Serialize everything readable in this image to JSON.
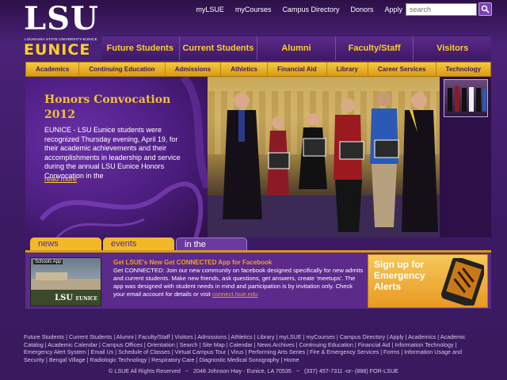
{
  "logo": {
    "main": "LSU",
    "tagline": "LOUISIANA STATE UNIVERSITY-EUNICE",
    "secondary": "EUNICE"
  },
  "utility_links": [
    "myLSUE",
    "myCourses",
    "Campus Directory",
    "Donors",
    "Apply"
  ],
  "search": {
    "placeholder": "search"
  },
  "main_nav": [
    "Future Students",
    "Current Students",
    "Alumni",
    "Faculty/Staff",
    "Visitors"
  ],
  "sub_nav": [
    "Academics",
    "Continuing Education",
    "Admissions",
    "Athletics",
    "Financial Aid",
    "Library",
    "Career Services",
    "Technology"
  ],
  "hero": {
    "title": "Honors Convocation 2012",
    "body": "EUNICE - LSU Eunice students were recognized Thursday evening, April 19, for their academic achievements and their accomplishments in leadership and service during the annual LSU Eunice Honors Convocation in the",
    "read_more": "read more"
  },
  "tabs": [
    "news",
    "events",
    "in the spotlight"
  ],
  "feature": {
    "image_label": "Schools App",
    "image_logo": "LSU",
    "image_logo_sub": "EUNICE",
    "title": "Get LSUE's New Get CONNECTED App for Facebook",
    "body": "Get CONNECTED: Join our new community on facebook designed specifically for new admits and current students. Make new friends, ask questions, get answers, create 'meetups'. The app was designed with student needs in mind and participation is by invitation only. Check your email account for details or visit ",
    "link": "connect.lsue.edu",
    "alerts_text": "Sign up for Emergency Alerts"
  },
  "footer": {
    "links": "Future Students | Current Students | Alumni | Faculty/Staff | Visitors | Admissions | Athletics | Library | myLSUE | myCourses | Campus Directory | Apply | Academics | Academic Catalog | Academic Calendar | Campus Offices | Orientation | Search | Site Map | Calendar | News Archives | Continuing Education | Financial Aid | Information Technology | Emergency Alert System | Email Us | Schedule of Classes | Virtual Campus Tour | Virus | Performing Arts Series | Fire & Emergency Services | Forms | Information Usage and Security | Bengal Village | Radiologic Technology | Respiratory Care | Diagnostic Medical Sonography | Home",
    "copyright": "© LSUE All Rights Reserved   ~   2048 Johnson Hwy - Eunice, LA 70535   ~   (337) 457-7311 -or- (888) FOR-LSUE"
  },
  "colors": {
    "purple": "#3a1a5e",
    "gold": "#fdd023",
    "accent_orange": "#f1a02a"
  }
}
